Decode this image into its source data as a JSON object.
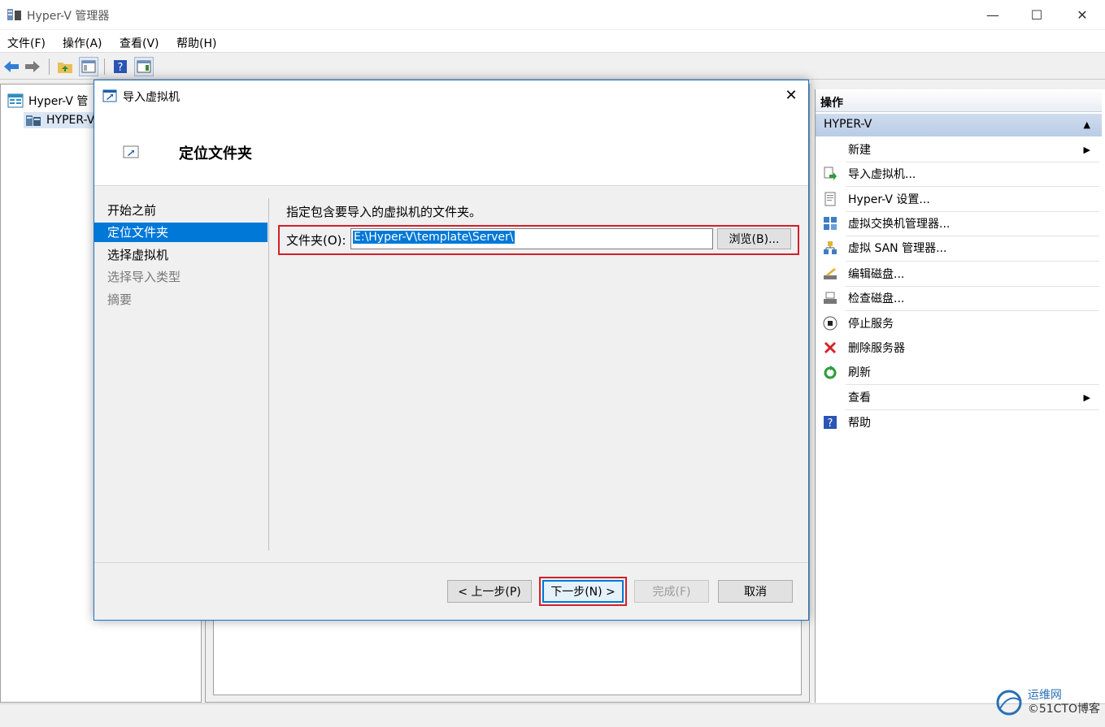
{
  "window": {
    "title": "Hyper-V 管理器"
  },
  "menu": [
    "文件(F)",
    "操作(A)",
    "查看(V)",
    "帮助(H)"
  ],
  "tree": {
    "root": "Hyper-V 管",
    "server": "HYPER-V"
  },
  "actions": {
    "header": "操作",
    "section": "HYPER-V",
    "items": [
      {
        "label": "新建",
        "icon": "none",
        "submenu": true
      },
      {
        "label": "导入虚拟机...",
        "icon": "import-vm-icon"
      },
      {
        "label": "Hyper-V 设置...",
        "icon": "settings-doc-icon"
      },
      {
        "label": "虚拟交换机管理器...",
        "icon": "switch-manager-icon"
      },
      {
        "label": "虚拟 SAN 管理器...",
        "icon": "san-manager-icon"
      },
      {
        "label": "编辑磁盘...",
        "icon": "edit-disk-icon"
      },
      {
        "label": "检查磁盘...",
        "icon": "inspect-disk-icon"
      },
      {
        "label": "停止服务",
        "icon": "stop-icon"
      },
      {
        "label": "删除服务器",
        "icon": "delete-icon"
      },
      {
        "label": "刷新",
        "icon": "refresh-icon"
      },
      {
        "label": "查看",
        "icon": "none",
        "submenu": true
      },
      {
        "label": "帮助",
        "icon": "help-icon"
      }
    ]
  },
  "dialog": {
    "title": "导入虚拟机",
    "heading": "定位文件夹",
    "nav": [
      {
        "label": "开始之前",
        "state": "normal"
      },
      {
        "label": "定位文件夹",
        "state": "selected"
      },
      {
        "label": "选择虚拟机",
        "state": "normal"
      },
      {
        "label": "选择导入类型",
        "state": "disabled"
      },
      {
        "label": "摘要",
        "state": "disabled"
      }
    ],
    "instruction": "指定包含要导入的虚拟机的文件夹。",
    "folder_label": "文件夹(O):",
    "folder_value": "E:\\Hyper-V\\template\\Server\\",
    "browse": "浏览(B)...",
    "buttons": {
      "prev": "< 上一步(P)",
      "next": "下一步(N) >",
      "finish": "完成(F)",
      "cancel": "取消"
    }
  },
  "watermark": {
    "line1": "运维网",
    "line2": "©51CTO博客"
  },
  "colors": {
    "accent": "#0078d7",
    "highlight_border": "#d2202a",
    "section_bg": "#c5d6ec"
  }
}
